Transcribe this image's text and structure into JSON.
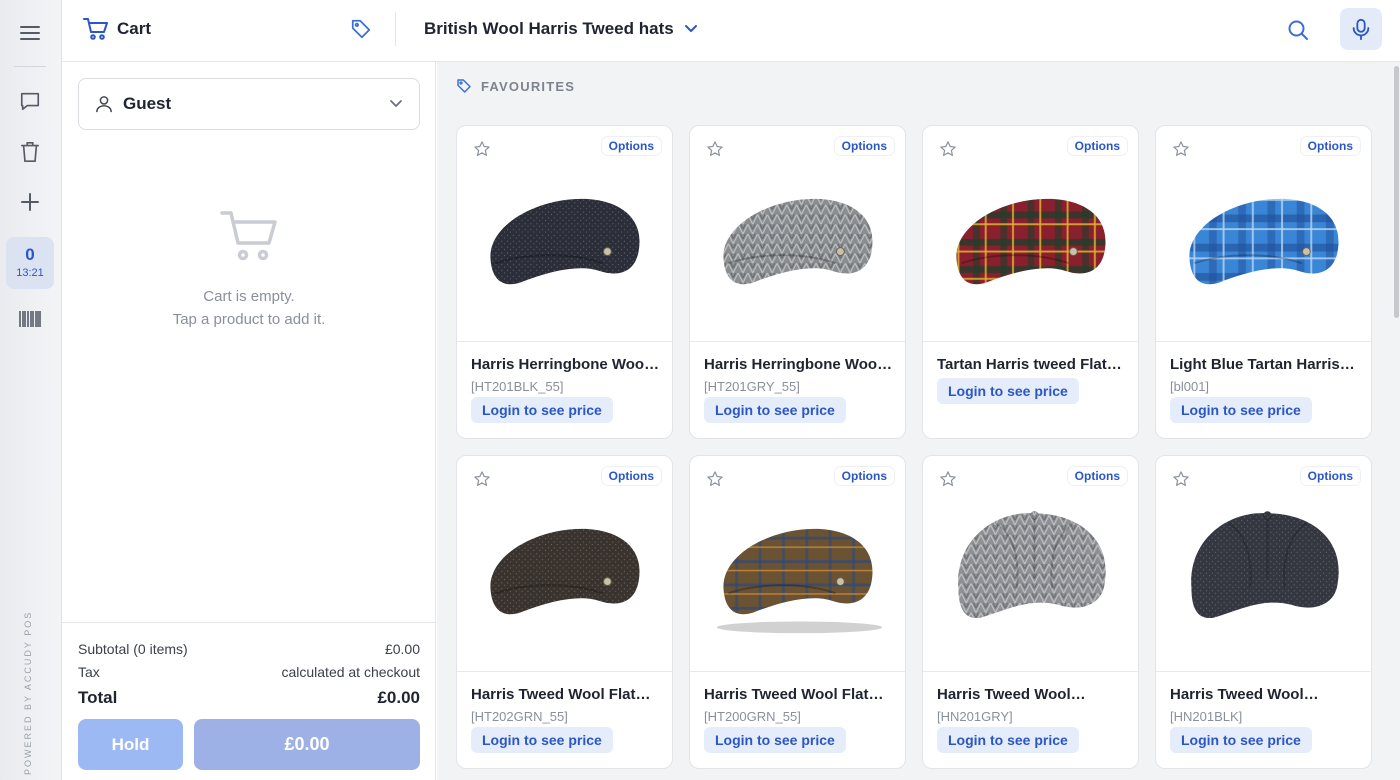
{
  "rail": {
    "order_count": "0",
    "order_time": "13:21",
    "powered_by": "POWERED BY ACCUDY POS"
  },
  "header": {
    "cart_label": "Cart",
    "category": "British Wool Harris Tweed hats"
  },
  "cart": {
    "customer": "Guest",
    "empty_line1": "Cart is empty.",
    "empty_line2": "Tap a product to add it.",
    "subtotal_label": "Subtotal (0 items)",
    "subtotal_value": "£0.00",
    "tax_label": "Tax",
    "tax_value": "calculated at checkout",
    "total_label": "Total",
    "total_value": "£0.00",
    "hold_label": "Hold",
    "pay_label": "£0.00"
  },
  "section": {
    "title": "FAVOURITES"
  },
  "products": [
    {
      "name": "Harris Herringbone Woo…",
      "sku": "[HT201BLK_55]",
      "options": "Options",
      "price": "Login to see price",
      "color": "#2b2e38",
      "pattern": "tweed"
    },
    {
      "name": "Harris Herringbone Woo…",
      "sku": "[HT201GRY_55]",
      "options": "Options",
      "price": "Login to see price",
      "color": "#8a8d90",
      "pattern": "herringbone"
    },
    {
      "name": "Tartan Harris tweed Flat…",
      "sku": "",
      "options": "Options",
      "price": "Login to see price",
      "color": "#8a1f2e",
      "pattern": "tartan"
    },
    {
      "name": "Light Blue Tartan Harris…",
      "sku": "[bl001]",
      "options": "Options",
      "price": "Login to see price",
      "color": "#3a86d6",
      "pattern": "bluetartan"
    },
    {
      "name": "Harris Tweed Wool Flat…",
      "sku": "[HT202GRN_55]",
      "options": "Options",
      "price": "Login to see price",
      "color": "#3a332d",
      "pattern": "tweed"
    },
    {
      "name": "Harris Tweed Wool Flat…",
      "sku": "[HT200GRN_55]",
      "options": "Options",
      "price": "Login to see price",
      "color": "#6a5232",
      "pattern": "check"
    },
    {
      "name": "Harris Tweed Wool…",
      "sku": "[HN201GRY]",
      "options": "Options",
      "price": "Login to see price",
      "color": "#8e9094",
      "pattern": "herringbone"
    },
    {
      "name": "Harris Tweed Wool…",
      "sku": "[HN201BLK]",
      "options": "Options",
      "price": "Login to see price",
      "color": "#34373f",
      "pattern": "tweed"
    }
  ],
  "colors": {
    "accent": "#2b56c6",
    "accent_light": "#e6edfa",
    "hold_button": "#9db9f4",
    "pay_button": "#9db1e6"
  }
}
